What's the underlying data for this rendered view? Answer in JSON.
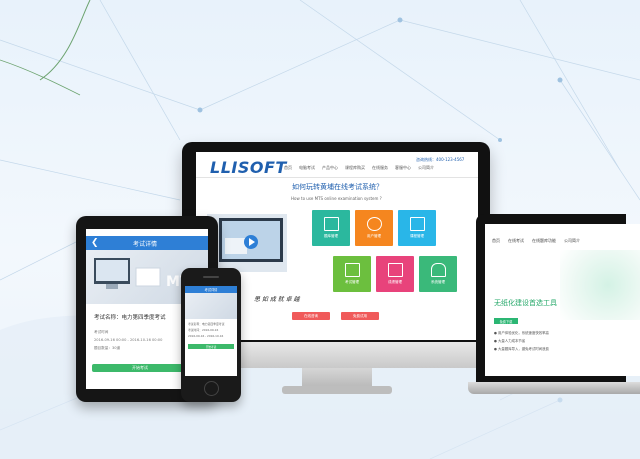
{
  "desktop": {
    "logo": "LLISOFT",
    "nav": [
      "首页",
      "电脑考试",
      "产品中心",
      "课程库购买",
      "在线服务",
      "客服中心",
      "公司简介"
    ],
    "hotline": "咨询热线：400-123-4567",
    "headline": "如何玩转黄埔在线考试系统？",
    "subline": "How to use MTS online examination system ?",
    "tiles": [
      {
        "label": "题库管理",
        "color": "#2bb89e",
        "icon": "book-icon"
      },
      {
        "label": "用户管理",
        "color": "#f5861f",
        "icon": "user-icon"
      },
      {
        "label": "课程管理",
        "color": "#29b6e8",
        "icon": "document-icon"
      },
      {
        "label": "考试管理",
        "color": "#6cbf3e",
        "icon": "exam-icon"
      },
      {
        "label": "成绩管理",
        "color": "#e8437b",
        "icon": "edit-icon"
      },
      {
        "label": "系统管理",
        "color": "#3ab97a",
        "icon": "home-icon"
      }
    ],
    "buttons": [
      {
        "label": "在线咨询",
        "color": "#f05a5a"
      },
      {
        "label": "免费试用",
        "color": "#f05a5a"
      }
    ],
    "signature": "思 如 成 就 卓 越"
  },
  "laptop": {
    "nav": [
      "首页",
      "在线考试",
      "在线题库功能",
      "公司简介"
    ],
    "title": "无纸化建设首选工具",
    "button": "免费下载",
    "items": [
      "● 用户体验优化，系统速度快效率高",
      "● 大量人力成本节省",
      "● 大量题库导入，避免考试时间浪费"
    ]
  },
  "tablet": {
    "back": "❮",
    "title": "考试详情",
    "exam_name": "考试名称：电力第四季度考试",
    "info": [
      "考试时间",
      "2016-09-16 00:00 - 2016-10-16 00:00",
      "题目数量：30道"
    ],
    "start": "开始考试"
  },
  "phone": {
    "title": "考试详情",
    "lines": [
      "考试名称：电力第四季度考试",
      "考试时间：2016-09-16",
      "2016-09-16 - 2016-10-16"
    ],
    "start": "开始考试"
  }
}
